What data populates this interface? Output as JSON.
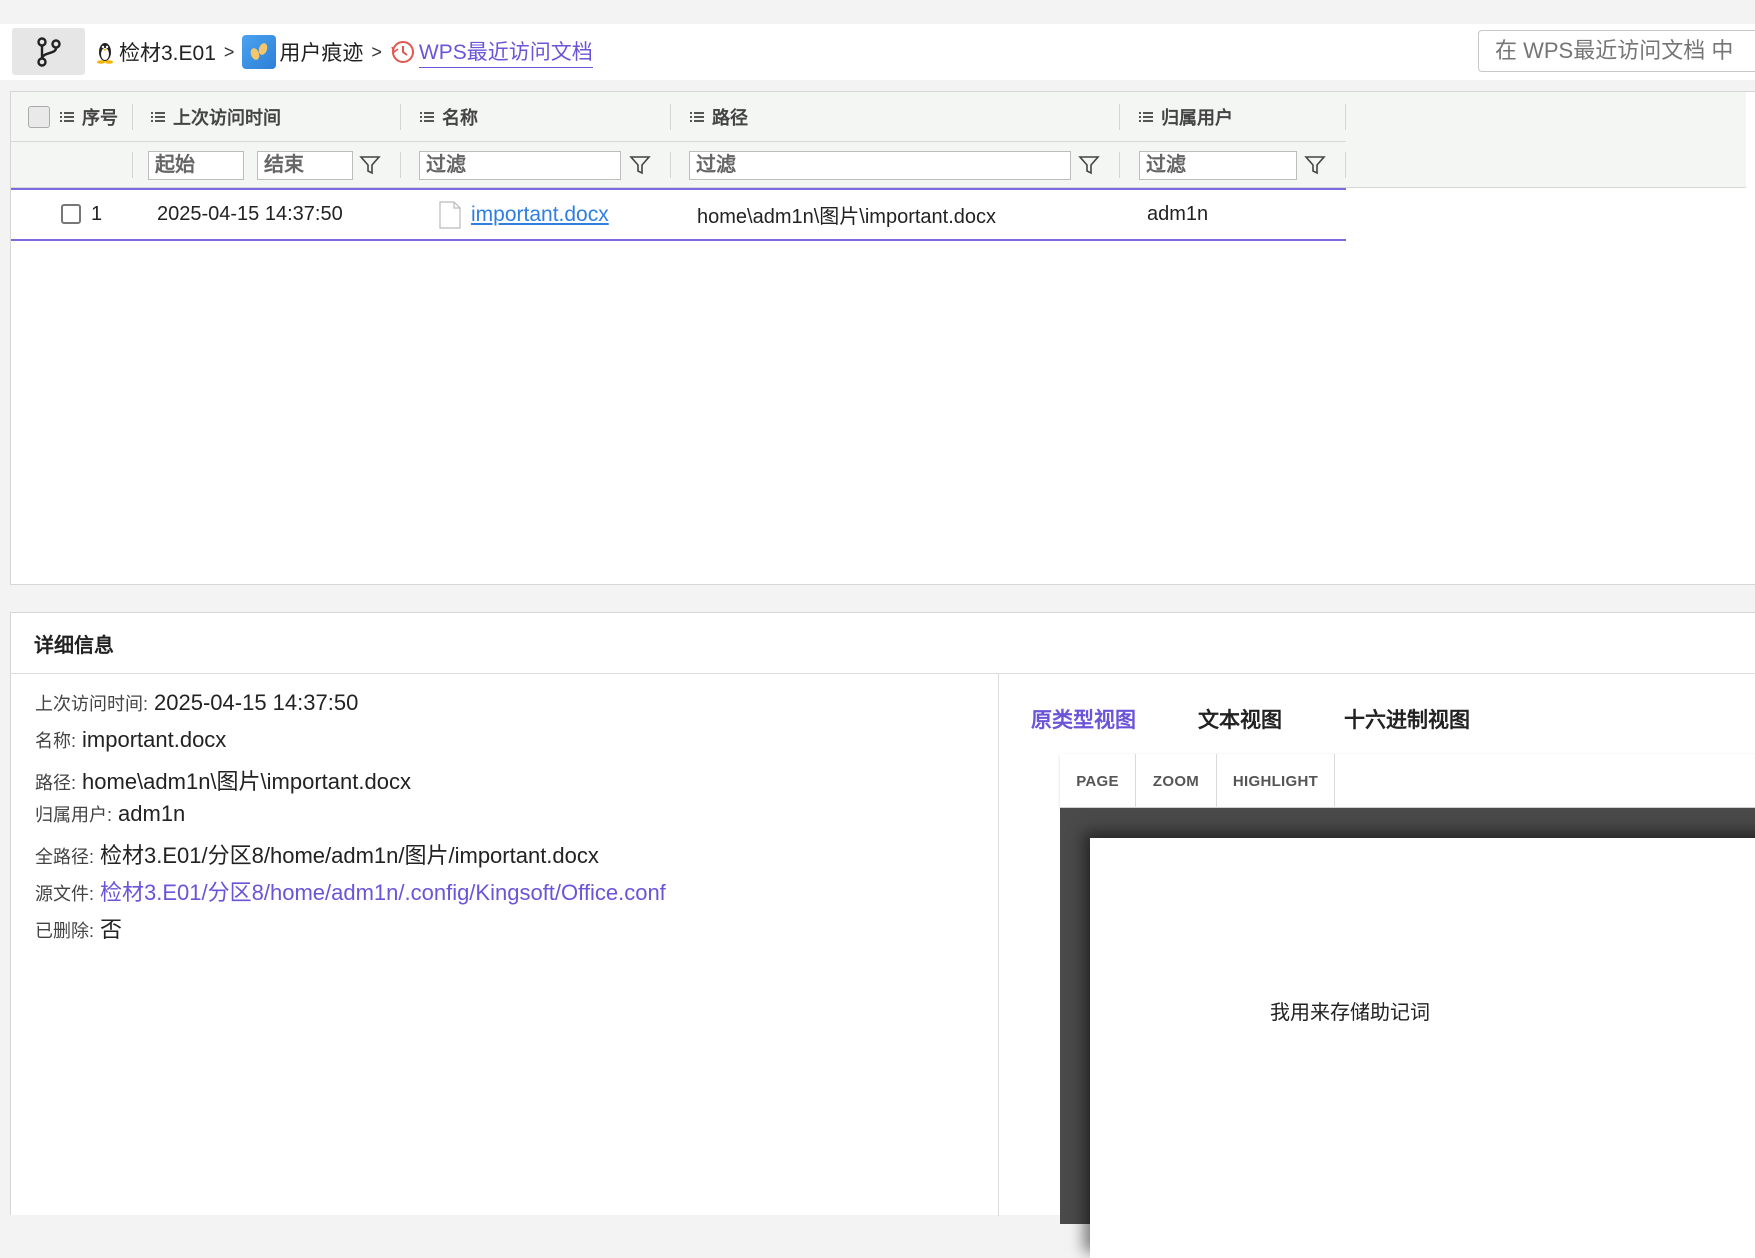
{
  "breadcrumb": {
    "items": [
      {
        "label": "检材3.E01",
        "icon": "linux-penguin-icon"
      },
      {
        "label": "用户痕迹",
        "icon": "footprints-icon"
      },
      {
        "label": "WPS最近访问文档",
        "icon": "clock-history-icon"
      }
    ],
    "separator": ">"
  },
  "search": {
    "placeholder": "在 WPS最近访问文档 中"
  },
  "table": {
    "columns": [
      {
        "key": "index",
        "label": "序号"
      },
      {
        "key": "last_access",
        "label": "上次访问时间"
      },
      {
        "key": "name",
        "label": "名称"
      },
      {
        "key": "path",
        "label": "路径"
      },
      {
        "key": "owner",
        "label": "归属用户"
      }
    ],
    "filters": {
      "start": "起始",
      "end": "结束",
      "name": "过滤",
      "path": "过滤",
      "owner": "过滤"
    },
    "rows": [
      {
        "index": "1",
        "last_access": "2025-04-15 14:37:50",
        "name": "important.docx",
        "path": "home\\adm1n\\图片\\important.docx",
        "owner": "adm1n"
      }
    ]
  },
  "details": {
    "title": "详细信息",
    "fields": [
      {
        "label": "上次访问时间:",
        "value": "2025-04-15 14:37:50"
      },
      {
        "label": "名称:",
        "value": "important.docx"
      },
      {
        "label": "路径:",
        "value": "home\\adm1n\\图片\\important.docx"
      },
      {
        "label": "归属用户:",
        "value": "adm1n"
      },
      {
        "label": "全路径:",
        "value": "检材3.E01/分区8/home/adm1n/图片/important.docx"
      },
      {
        "label": "源文件:",
        "value": "检材3.E01/分区8/home/adm1n/.config/Kingsoft/Office.conf"
      },
      {
        "label": "已删除:",
        "value": "否"
      }
    ]
  },
  "viewer": {
    "tabs": [
      "原类型视图",
      "文本视图",
      "十六进制视图"
    ],
    "active_tab": "原类型视图",
    "toolbar": [
      "PAGE",
      "ZOOM",
      "HIGHLIGHT"
    ],
    "document_text": "我用来存储助记词"
  },
  "colors": {
    "accent": "#6a55d9",
    "link": "#2f7fe0",
    "selection": "#7b6be0"
  }
}
